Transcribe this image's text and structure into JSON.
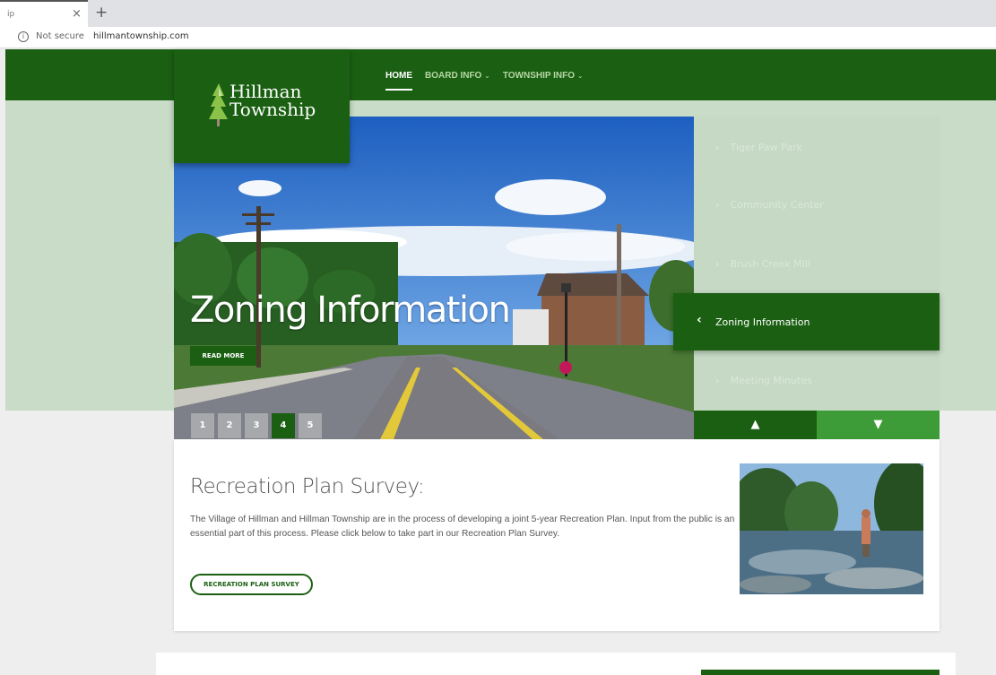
{
  "browser": {
    "tab_title": "ip",
    "security_label": "Not secure",
    "url": "hillmantownship.com"
  },
  "site": {
    "logo_line1": "Hillman",
    "logo_line2": "Township",
    "nav": [
      {
        "label": "HOME",
        "caret": ""
      },
      {
        "label": "BOARD INFO",
        "caret": "⌄"
      },
      {
        "label": "TOWNSHIP INFO",
        "caret": "⌄"
      }
    ]
  },
  "slider": {
    "caption": "Zoning Information",
    "read_more": "READ MORE",
    "pages": [
      "1",
      "2",
      "3",
      "4",
      "5"
    ],
    "active_page": "4",
    "side_items": [
      "Tiger Paw Park",
      "Community Center",
      "Brush Creek Mill",
      "Zoning Information",
      "Meeting Minutes"
    ],
    "active_item": "Zoning Information"
  },
  "survey": {
    "title": "Recreation Plan Survey:",
    "body": "The Village of Hillman and Hillman Township are in the process of developing a joint 5-year Recreation Plan. Input from the public is an essential part of this process. Please click below to take part in our Recreation Plan Survey.",
    "button": "RECREATION PLAN SURVEY"
  },
  "colors": {
    "brand_green": "#1b6012",
    "light_green": "#c9dcc8",
    "accent_green": "#3d9c37"
  },
  "icons": [
    "info-icon",
    "tree-icon",
    "chevron-left-icon",
    "chevron-right-icon",
    "arrow-up-icon",
    "arrow-down-icon",
    "close-icon",
    "plus-icon"
  ]
}
